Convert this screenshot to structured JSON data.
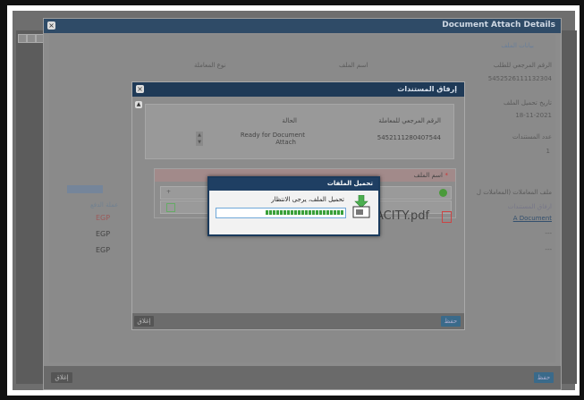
{
  "outer_window": {
    "title": "Document Attach Details",
    "section_header": "بيانات الملف",
    "label_request_ref": "الرقم المرجعي للطلب",
    "value_request_ref": "5452526111132304",
    "label_upload_date": "تاريخ تحميل الملف",
    "value_upload_date": "18-11-2021",
    "label_doc_count": "عدد المستندات",
    "value_doc_count": "1",
    "col_file_name": "اسم الملف",
    "col_process_type": "نوع المعاملة",
    "grid_header": "ملف المعاملات (المعاملات ل",
    "attachments_link_label": "ارفاق المستندات",
    "attachments_link_value": "A Document",
    "dash_1": "---",
    "dash_2": "---",
    "currency_col": "عملة الدفع",
    "currency_1": "EGP",
    "currency_2": "EGP",
    "currency_3": "EGP",
    "close_button": "إغلاق",
    "ok_button": "حفظ"
  },
  "inner_dialog": {
    "title": "إرفاق المستندات",
    "label_ref": "الرقم المرجعي للمعاملة",
    "value_ref": "5452111280407544",
    "label_status": "الحالة",
    "value_status_line1": "Ready for Document",
    "value_status_line2": "Attach",
    "file_name_label": "اسم الملف",
    "required_mark": "*",
    "file_name_value": "ACITY.pdf",
    "close_button": "إغلاق",
    "save_button": "حفظ"
  },
  "upload_popup": {
    "title": "تحميل الملفات",
    "message": "تحميل الملف، يرجى الانتظار",
    "progress_fraction": 0.62
  },
  "colors": {
    "title_bar": "#1f3a57",
    "progress": "#3aa03a",
    "button": "#3a6a8a"
  }
}
